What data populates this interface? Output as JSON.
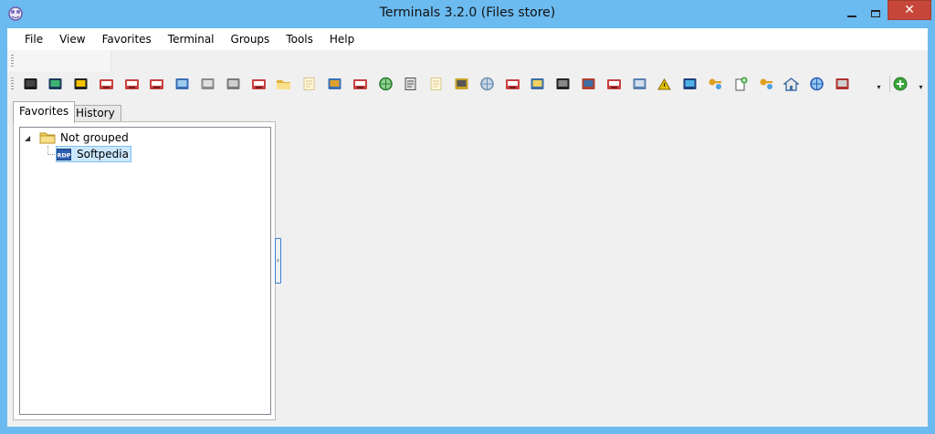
{
  "window": {
    "title": "Terminals 3.2.0 (Files store)",
    "close_glyph": "✕",
    "accent_color": "#6cbbf0",
    "close_color": "#c7463a"
  },
  "menu": [
    {
      "label": "File"
    },
    {
      "label": "View"
    },
    {
      "label": "Favorites"
    },
    {
      "label": "Terminal"
    },
    {
      "label": "Groups"
    },
    {
      "label": "Tools"
    },
    {
      "label": "Help"
    }
  ],
  "toolbar": {
    "icons": [
      "console-icon",
      "terminal-icon",
      "vnc-icon",
      "connection-icon",
      "connection-icon",
      "connection-icon",
      "network-computer-icon",
      "printer-icon",
      "scanner-icon",
      "connection-icon",
      "folder-icon",
      "script-icon",
      "network-users-icon",
      "connection-icon",
      "globe-icon",
      "copy-icon",
      "script-icon",
      "lock-icon",
      "gear-icon",
      "connection-icon",
      "notebook-icon",
      "film-icon",
      "package-icon",
      "connection-icon",
      "computers-icon",
      "warning-icon",
      "monitor-icon",
      "key-icon",
      "file-add-icon",
      "key-icon",
      "home-icon",
      "globe-link-icon",
      "tools-icon"
    ],
    "overflow_glyph": "▾",
    "add_icon": "add-icon"
  },
  "tabs": {
    "favorites": "Favorites",
    "history": "History"
  },
  "tree": {
    "group_label": "Not grouped",
    "expander_glyph": "◢",
    "child_label": "Softpedia",
    "child_icon": "rdp-icon"
  },
  "splitter": {
    "glyph": "‹"
  }
}
